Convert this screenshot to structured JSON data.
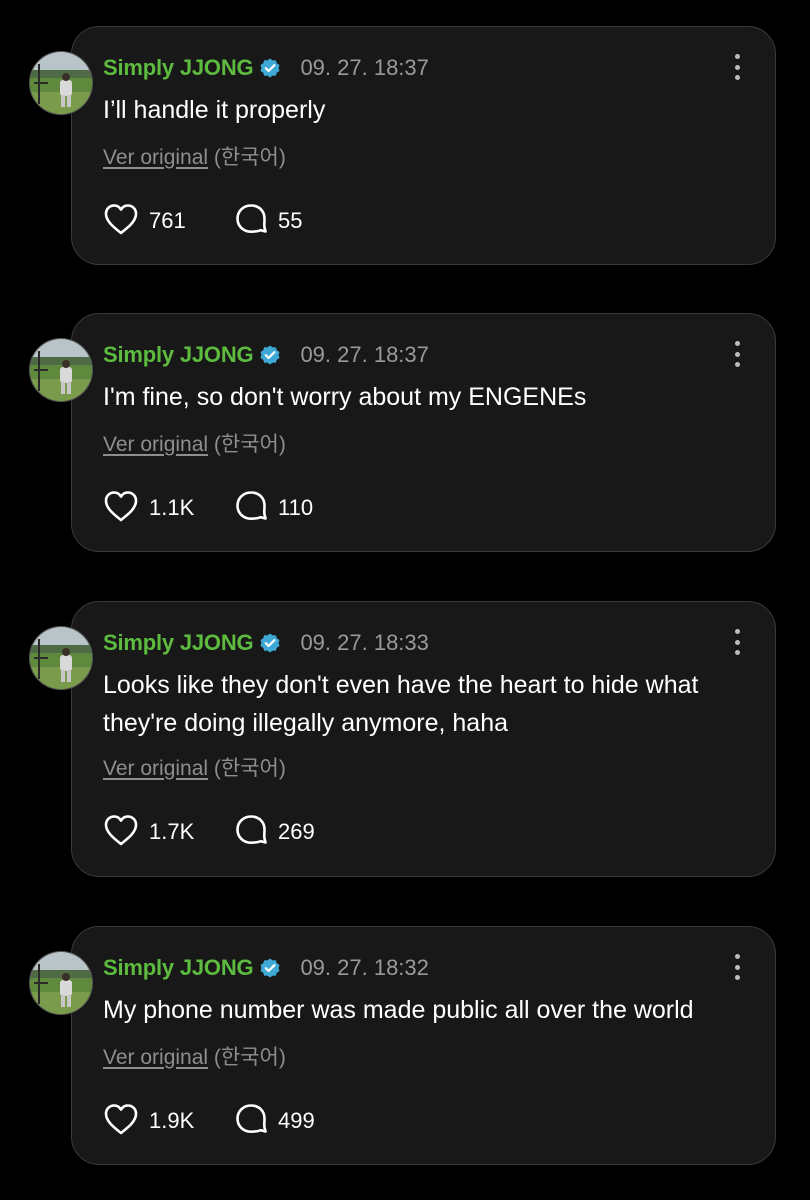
{
  "colors": {
    "background": "#000000",
    "card": "#181818",
    "card_border": "#3a3a3a",
    "username": "#5dbb3f",
    "verified_badge": "#3fa9d6",
    "date": "#9a9a9a",
    "translate_text": "#8e8e8e"
  },
  "icons": {
    "verified": "verified-badge-icon",
    "more": "vertical-dots-icon",
    "like": "heart-icon",
    "comment": "speech-bubble-icon"
  },
  "posts": [
    {
      "username": "Simply JJONG",
      "timestamp": "09. 27. 18:37",
      "text": "I’ll handle it properly",
      "translate_link": "Ver original",
      "translate_lang": "(한국어)",
      "likes": "761",
      "comments": "55"
    },
    {
      "username": "Simply JJONG",
      "timestamp": "09. 27. 18:37",
      "text": "I'm fine, so don't worry about my ENGENEs",
      "translate_link": "Ver original",
      "translate_lang": "(한국어)",
      "likes": "1.1K",
      "comments": "110"
    },
    {
      "username": "Simply JJONG",
      "timestamp": "09. 27. 18:33",
      "text": "Looks like they don't even have the heart to hide what they're doing illegally anymore, haha",
      "translate_link": "Ver original",
      "translate_lang": "(한국어)",
      "likes": "1.7K",
      "comments": "269"
    },
    {
      "username": "Simply JJONG",
      "timestamp": "09. 27. 18:32",
      "text": "My phone number was made public all over the world",
      "translate_link": "Ver original",
      "translate_lang": "(한국어)",
      "likes": "1.9K",
      "comments": "499"
    }
  ]
}
